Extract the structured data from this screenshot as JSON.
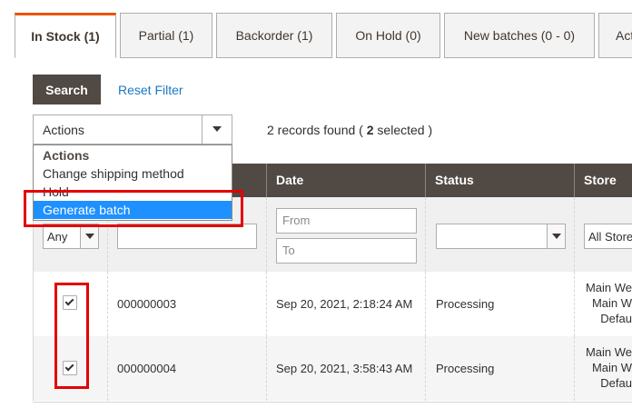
{
  "tabs": [
    {
      "label": "In Stock (1)"
    },
    {
      "label": "Partial (1)"
    },
    {
      "label": "Backorder (1)"
    },
    {
      "label": "On Hold (0)"
    },
    {
      "label": "New batches (0 - 0)"
    },
    {
      "label": "Act"
    }
  ],
  "toolbar": {
    "search_label": "Search",
    "reset_label": "Reset Filter",
    "actions_selected": "Actions",
    "records_prefix": "2 records found (",
    "records_selected_count": "2",
    "records_suffix": "selected )"
  },
  "actions_dropdown": {
    "header": "Actions",
    "items": [
      "Change shipping method",
      "Hold",
      "Generate batch"
    ],
    "selected": "Generate batch"
  },
  "grid": {
    "columns": [
      "Date",
      "Status",
      "Store"
    ],
    "filters": {
      "massaction_value": "Any",
      "date_from_placeholder": "From",
      "date_to_placeholder": "To",
      "store_value": "All Store"
    },
    "rows": [
      {
        "checked": true,
        "order_id": "000000003",
        "date": "Sep 20, 2021, 2:18:24 AM",
        "status": "Processing",
        "store": [
          "Main We",
          "Main W",
          "Defau"
        ]
      },
      {
        "checked": true,
        "order_id": "000000004",
        "date": "Sep 20, 2021, 3:58:43 AM",
        "status": "Processing",
        "store": [
          "Main We",
          "Main W",
          "Defau"
        ]
      }
    ]
  },
  "colors": {
    "header_bg": "#514943",
    "active_tab_accent": "#eb5202",
    "link": "#1979c3",
    "dropdown_selected": "#1e90ff",
    "highlight": "#e30000"
  }
}
